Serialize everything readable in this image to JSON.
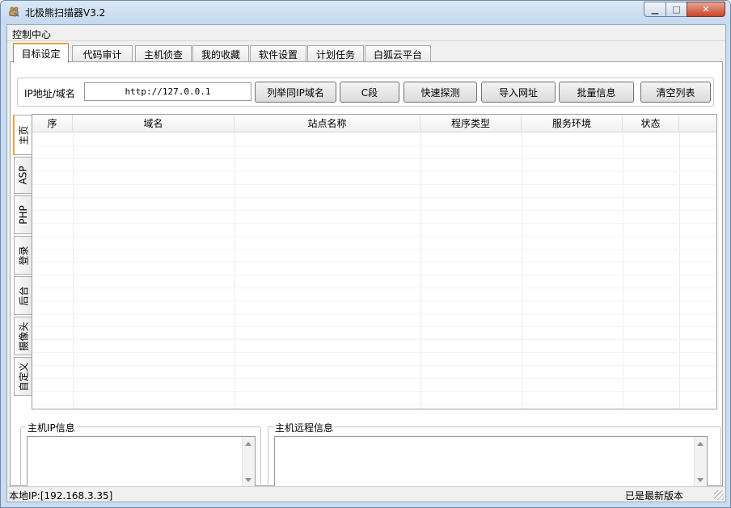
{
  "window": {
    "title": "北极熊扫描器V3.2",
    "minimize_glyph": "▁",
    "maximize_glyph": "□",
    "close_glyph": "✕"
  },
  "menu": {
    "items": [
      "控制中心"
    ]
  },
  "tabs": [
    "目标设定",
    "代码审计",
    "主机侦查",
    "我的收藏",
    "软件设置",
    "计划任务",
    "白狐云平台"
  ],
  "active_tab": "目标设定",
  "url": {
    "label": "IP地址/域名",
    "value": "http://127.0.0.1"
  },
  "buttons": [
    "列举同IP域名",
    "C段",
    "快速探测",
    "导入网址",
    "批量信息",
    "清空列表"
  ],
  "side_tabs": [
    "主页",
    "ASP",
    "PHP",
    "登录",
    "后台",
    "摄像头",
    "自定义"
  ],
  "active_side_tab": "主页",
  "table": {
    "columns": [
      "序",
      "域名",
      "站点名称",
      "程序类型",
      "服务环境",
      "状态"
    ],
    "rows": []
  },
  "panels": {
    "host_ip_info": "主机IP信息",
    "host_remote_info": "主机远程信息"
  },
  "status": {
    "local_ip": "本地IP:[192.168.3.35]",
    "version": "已是最新版本"
  },
  "colors": {
    "accent": "#e7a33e",
    "titlebar": "#c4d8ef",
    "close": "#c7452a"
  }
}
